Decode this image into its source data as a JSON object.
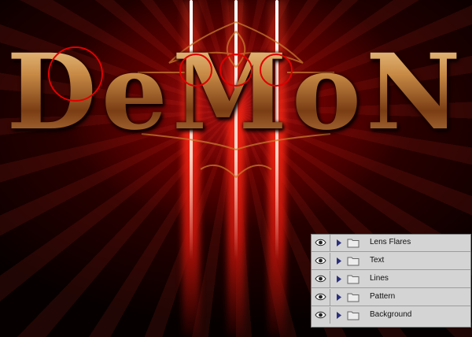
{
  "artwork": {
    "title_text": "DeMoN"
  },
  "layers_panel": {
    "layers": [
      {
        "name": "Lens Flares",
        "visible": true,
        "icon": "eye-icon"
      },
      {
        "name": "Text",
        "visible": true,
        "icon": "eye-icon"
      },
      {
        "name": "Lines",
        "visible": true,
        "icon": "eye-icon"
      },
      {
        "name": "Pattern",
        "visible": true,
        "icon": "eye-icon"
      },
      {
        "name": "Background",
        "visible": true,
        "icon": "eye-icon"
      }
    ]
  },
  "colors": {
    "highlight_circle": "#e00000",
    "panel_background": "#d4d4d4",
    "beam_red": "#ff2a10"
  }
}
